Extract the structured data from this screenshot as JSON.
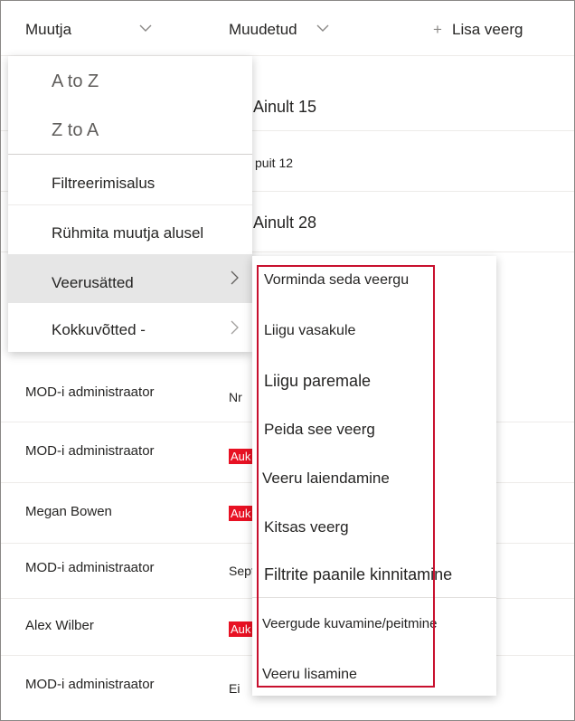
{
  "header": {
    "col_author": "Muutja",
    "col_modified": "Muudetud",
    "add_column": "Lisa veerg",
    "plus_glyph": "+"
  },
  "rows": [
    {
      "author": "",
      "modified": "Ainult 15"
    },
    {
      "author": "",
      "modified": "puit 12"
    },
    {
      "author": "",
      "modified": "Ainult 28"
    },
    {
      "author": "MOD-i administraator",
      "modified": "Nr"
    },
    {
      "author": "MOD-i administraator",
      "modified": "Auk"
    },
    {
      "author": "Megan Bowen",
      "modified": "Auk"
    },
    {
      "author": "MOD-i administraator",
      "modified": "Sept"
    },
    {
      "author": "Alex Wilber",
      "modified": "Auk"
    },
    {
      "author": "MOD-i administraator",
      "modified": "Ei"
    }
  ],
  "column_menu": {
    "sort_az": "A to Z",
    "sort_za": "Z to A",
    "filter_by": "Filtreerimisalus",
    "group_by": "Rühmita muutja alusel",
    "column_settings": "Veerusätted",
    "totals": "Kokkuvõtted -"
  },
  "settings_submenu": {
    "format": "Vorminda seda veergu",
    "move_left": "Liigu vasakule",
    "move_right": "Liigu paremale",
    "hide": "Peida see veerg",
    "expand": "Veeru laiendamine",
    "narrow": "Kitsas veerg",
    "pin_filters": "Filtrite paanile kinnitamine",
    "show_hide": "Veergude kuvamine/peitmine",
    "add_column": "Veeru lisamine"
  },
  "colors": {
    "badge": "#e81123",
    "highlight_box": "#c8102e",
    "menu_hover": "#e6e6e6"
  }
}
